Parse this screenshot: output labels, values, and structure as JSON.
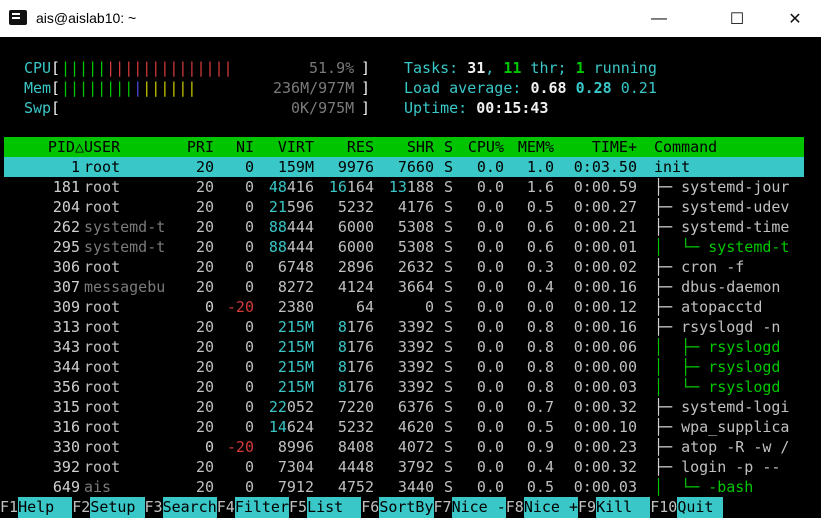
{
  "window": {
    "title": "ais@aislab10: ~",
    "minimize": "—",
    "maximize": "☐",
    "close": "✕"
  },
  "meters": {
    "cpu_label": "CPU",
    "cpu_value": "51.9%",
    "mem_label": "Mem",
    "mem_value": "236M/977M",
    "swp_label": "Swp",
    "swp_value": "0K/975M"
  },
  "summary": {
    "tasks_label": "Tasks: ",
    "tasks": "31",
    "thr": "11",
    "thr_label": " thr; ",
    "running": "1",
    "running_label": " running",
    "load_label": "Load average: ",
    "load1": "0.68",
    "load5": "0.28",
    "load15": "0.21",
    "uptime_label": "Uptime: ",
    "uptime": "00:15:43"
  },
  "columns": [
    "PID△",
    "USER",
    "PRI",
    "NI",
    "VIRT",
    "RES",
    "SHR",
    "S",
    "CPU%",
    "MEM%",
    "TIME+",
    "Command"
  ],
  "processes": [
    {
      "pid": "1",
      "user": "root",
      "pri": "20",
      "ni": "0",
      "virt": "159M",
      "res": "9976",
      "shr": "7660",
      "s": "S",
      "cpu": "0.0",
      "mem": "1.0",
      "time": "0:03.50",
      "tree": "",
      "cmd": "init"
    },
    {
      "pid": "181",
      "user": "root",
      "pri": "20",
      "ni": "0",
      "virt": "48416",
      "res": "16164",
      "shr": "13188",
      "s": "S",
      "cpu": "0.0",
      "mem": "1.6",
      "time": "0:00.59",
      "tree": "├─ ",
      "cmd": "systemd-jour"
    },
    {
      "pid": "204",
      "user": "root",
      "pri": "20",
      "ni": "0",
      "virt": "21596",
      "res": "5232",
      "shr": "4176",
      "s": "S",
      "cpu": "0.0",
      "mem": "0.5",
      "time": "0:00.27",
      "tree": "├─ ",
      "cmd": "systemd-udev"
    },
    {
      "pid": "262",
      "user": "systemd-t",
      "pri": "20",
      "ni": "0",
      "virt": "88444",
      "res": "6000",
      "shr": "5308",
      "s": "S",
      "cpu": "0.0",
      "mem": "0.6",
      "time": "0:00.21",
      "tree": "├─ ",
      "cmd": "systemd-time"
    },
    {
      "pid": "295",
      "user": "systemd-t",
      "pri": "20",
      "ni": "0",
      "virt": "88444",
      "res": "6000",
      "shr": "5308",
      "s": "S",
      "cpu": "0.0",
      "mem": "0.6",
      "time": "0:00.01",
      "tree": "│  └─ ",
      "cmd": "systemd-t"
    },
    {
      "pid": "306",
      "user": "root",
      "pri": "20",
      "ni": "0",
      "virt": "6748",
      "res": "2896",
      "shr": "2632",
      "s": "S",
      "cpu": "0.0",
      "mem": "0.3",
      "time": "0:00.02",
      "tree": "├─ ",
      "cmd": "cron -f"
    },
    {
      "pid": "307",
      "user": "messagebu",
      "pri": "20",
      "ni": "0",
      "virt": "8272",
      "res": "4124",
      "shr": "3664",
      "s": "S",
      "cpu": "0.0",
      "mem": "0.4",
      "time": "0:00.16",
      "tree": "├─ ",
      "cmd": "dbus-daemon"
    },
    {
      "pid": "309",
      "user": "root",
      "pri": "0",
      "ni": "-20",
      "virt": "2380",
      "res": "64",
      "shr": "0",
      "s": "S",
      "cpu": "0.0",
      "mem": "0.0",
      "time": "0:00.12",
      "tree": "├─ ",
      "cmd": "atopacctd"
    },
    {
      "pid": "313",
      "user": "root",
      "pri": "20",
      "ni": "0",
      "virt": "215M",
      "res": "8176",
      "shr": "3392",
      "s": "S",
      "cpu": "0.0",
      "mem": "0.8",
      "time": "0:00.16",
      "tree": "├─ ",
      "cmd": "rsyslogd -n"
    },
    {
      "pid": "343",
      "user": "root",
      "pri": "20",
      "ni": "0",
      "virt": "215M",
      "res": "8176",
      "shr": "3392",
      "s": "S",
      "cpu": "0.0",
      "mem": "0.8",
      "time": "0:00.06",
      "tree": "│  ├─ ",
      "cmd": "rsyslogd"
    },
    {
      "pid": "344",
      "user": "root",
      "pri": "20",
      "ni": "0",
      "virt": "215M",
      "res": "8176",
      "shr": "3392",
      "s": "S",
      "cpu": "0.0",
      "mem": "0.8",
      "time": "0:00.00",
      "tree": "│  ├─ ",
      "cmd": "rsyslogd"
    },
    {
      "pid": "356",
      "user": "root",
      "pri": "20",
      "ni": "0",
      "virt": "215M",
      "res": "8176",
      "shr": "3392",
      "s": "S",
      "cpu": "0.0",
      "mem": "0.8",
      "time": "0:00.03",
      "tree": "│  └─ ",
      "cmd": "rsyslogd"
    },
    {
      "pid": "315",
      "user": "root",
      "pri": "20",
      "ni": "0",
      "virt": "22052",
      "res": "7220",
      "shr": "6376",
      "s": "S",
      "cpu": "0.0",
      "mem": "0.7",
      "time": "0:00.32",
      "tree": "├─ ",
      "cmd": "systemd-logi"
    },
    {
      "pid": "316",
      "user": "root",
      "pri": "20",
      "ni": "0",
      "virt": "14624",
      "res": "5232",
      "shr": "4620",
      "s": "S",
      "cpu": "0.0",
      "mem": "0.5",
      "time": "0:00.10",
      "tree": "├─ ",
      "cmd": "wpa_supplica"
    },
    {
      "pid": "330",
      "user": "root",
      "pri": "0",
      "ni": "-20",
      "virt": "8996",
      "res": "8408",
      "shr": "4072",
      "s": "S",
      "cpu": "0.0",
      "mem": "0.9",
      "time": "0:00.23",
      "tree": "├─ ",
      "cmd": "atop -R -w /"
    },
    {
      "pid": "392",
      "user": "root",
      "pri": "20",
      "ni": "0",
      "virt": "7304",
      "res": "4448",
      "shr": "3792",
      "s": "S",
      "cpu": "0.0",
      "mem": "0.4",
      "time": "0:00.32",
      "tree": "├─ ",
      "cmd": "login -p --"
    },
    {
      "pid": "649",
      "user": "ais",
      "pri": "20",
      "ni": "0",
      "virt": "7912",
      "res": "4752",
      "shr": "3440",
      "s": "S",
      "cpu": "0.0",
      "mem": "0.5",
      "time": "0:00.03",
      "tree": "│  └─ ",
      "cmd": "-bash"
    }
  ],
  "function_keys": [
    {
      "key": "F1",
      "label": "Help"
    },
    {
      "key": "F2",
      "label": "Setup"
    },
    {
      "key": "F3",
      "label": "Search"
    },
    {
      "key": "F4",
      "label": "Filter"
    },
    {
      "key": "F5",
      "label": "List"
    },
    {
      "key": "F6",
      "label": "SortBy"
    },
    {
      "key": "F7",
      "label": "Nice -"
    },
    {
      "key": "F8",
      "label": "Nice +"
    },
    {
      "key": "F9",
      "label": "Kill"
    },
    {
      "key": "F10",
      "label": "Quit"
    }
  ],
  "colors": {
    "header_bg": "#00c400",
    "selected_bg": "#3ac7c7",
    "label_cyan": "#3ac7c7",
    "tree_green": "#00c800",
    "nice_red": "#d43a3a"
  }
}
